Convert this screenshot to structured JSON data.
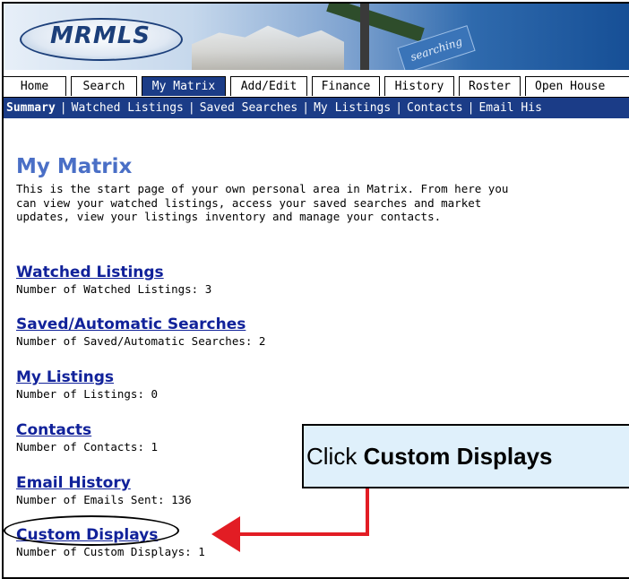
{
  "banner": {
    "logo_text": "MRMLS",
    "sign_text": "searching"
  },
  "tabs": [
    {
      "label": "Home",
      "active": false
    },
    {
      "label": "Search",
      "active": false
    },
    {
      "label": "My Matrix",
      "active": true
    },
    {
      "label": "Add/Edit",
      "active": false
    },
    {
      "label": "Finance",
      "active": false
    },
    {
      "label": "History",
      "active": false
    },
    {
      "label": "Roster",
      "active": false
    },
    {
      "label": "Open House",
      "active": false
    }
  ],
  "subnav": [
    {
      "label": "Summary",
      "active": true
    },
    {
      "label": "Watched Listings",
      "active": false
    },
    {
      "label": "Saved Searches",
      "active": false
    },
    {
      "label": "My Listings",
      "active": false
    },
    {
      "label": "Contacts",
      "active": false
    },
    {
      "label": "Email His",
      "active": false
    }
  ],
  "main": {
    "title": "My Matrix",
    "intro": "This is the start page of your own personal area in Matrix. From here you can view your watched listings, access your saved searches and market updates, view your listings inventory and manage your contacts.",
    "sections": [
      {
        "link": "Watched Listings",
        "count": "Number of Watched Listings: 3"
      },
      {
        "link": "Saved/Automatic Searches",
        "count": "Number of Saved/Automatic Searches: 2"
      },
      {
        "link": "My Listings",
        "count": "Number of Listings: 0"
      },
      {
        "link": "Contacts",
        "count": "Number of Contacts: 1"
      },
      {
        "link": "Email History",
        "count": "Number of Emails Sent: 136"
      },
      {
        "link": "Custom Displays",
        "count": "Number of Custom Displays: 1"
      }
    ]
  },
  "callout": {
    "prefix": "Click ",
    "target": "Custom Displays"
  },
  "colors": {
    "accent": "#1b3c87",
    "link": "#11229a",
    "title": "#4a6fc6",
    "callout_bg": "#dff0fb",
    "arrow": "#e21d24"
  }
}
